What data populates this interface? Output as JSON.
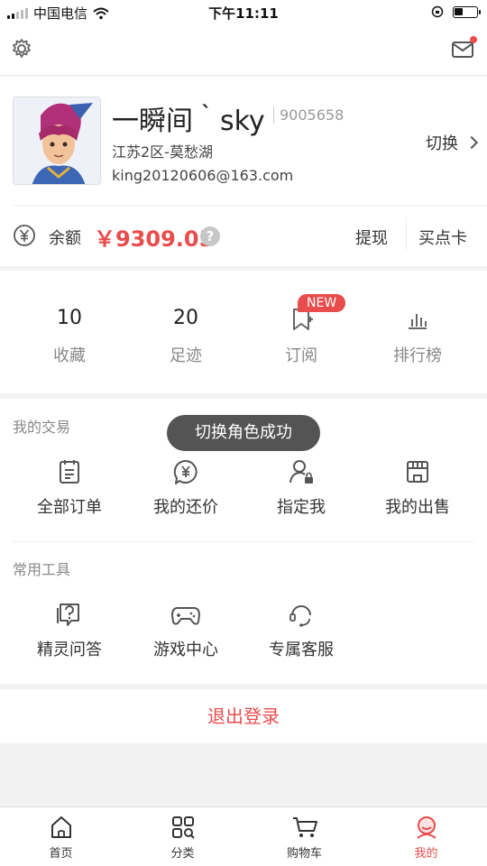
{
  "status_bar": {
    "carrier": "中国电信",
    "time": "下午11:11"
  },
  "profile": {
    "name": "一瞬间｀sky",
    "uid": "9005658",
    "server": "江苏2区-莫愁湖",
    "email": "king20120606@163.com",
    "switch_label": "切换"
  },
  "balance": {
    "label": "余额",
    "value": "￥9309.05",
    "withdraw": "提现",
    "buy_card": "买点卡"
  },
  "stats": [
    {
      "num": "10",
      "label": "收藏"
    },
    {
      "num": "20",
      "label": "足迹"
    },
    {
      "num": "",
      "label": "订阅"
    },
    {
      "num": "",
      "label": "排行榜"
    }
  ],
  "new_badge": "NEW",
  "trade": {
    "title": "我的交易",
    "items": [
      {
        "label": "全部订单",
        "icon": "orders-icon"
      },
      {
        "label": "我的还价",
        "icon": "counter-offer-icon"
      },
      {
        "label": "指定我",
        "icon": "designated-icon"
      },
      {
        "label": "我的出售",
        "icon": "shop-icon"
      }
    ]
  },
  "tools": {
    "title": "常用工具",
    "items": [
      {
        "label": "精灵问答",
        "icon": "faq-icon"
      },
      {
        "label": "游戏中心",
        "icon": "gamepad-icon"
      },
      {
        "label": "专属客服",
        "icon": "headset-icon"
      }
    ]
  },
  "toast": "切换角色成功",
  "logout": "退出登录",
  "tabs": [
    {
      "label": "首页",
      "icon": "home-icon"
    },
    {
      "label": "分类",
      "icon": "category-icon"
    },
    {
      "label": "购物车",
      "icon": "cart-icon"
    },
    {
      "label": "我的",
      "icon": "profile-icon"
    }
  ],
  "colors": {
    "accent": "#e84c4c",
    "background": "#f2f2f2"
  }
}
